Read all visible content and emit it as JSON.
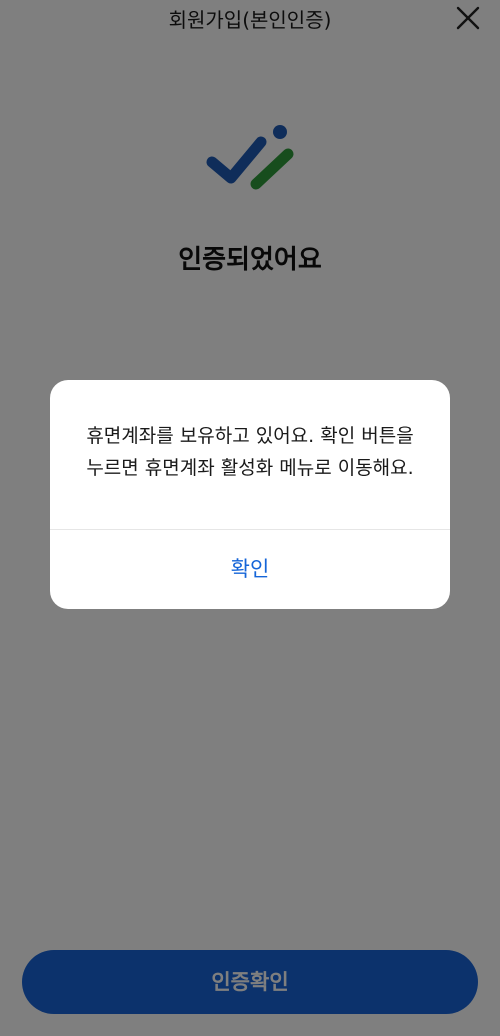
{
  "header": {
    "title": "회원가입(본인인증)",
    "close_icon": "close-icon"
  },
  "logo": {
    "icon": "verified-check-logo-icon",
    "colors": {
      "blue": "#1f5bb5",
      "green": "#2e9b3a"
    }
  },
  "main": {
    "headline": "인증되었어요"
  },
  "footer": {
    "primary_button_label": "인증확인",
    "primary_color": "#1865d8"
  },
  "dialog": {
    "message": "휴면계좌를 보유하고 있어요. 확인 버튼을\n누르면 휴면계좌 활성화 메뉴로 이동해요.",
    "confirm_label": "확인",
    "confirm_color": "#1565d8"
  }
}
